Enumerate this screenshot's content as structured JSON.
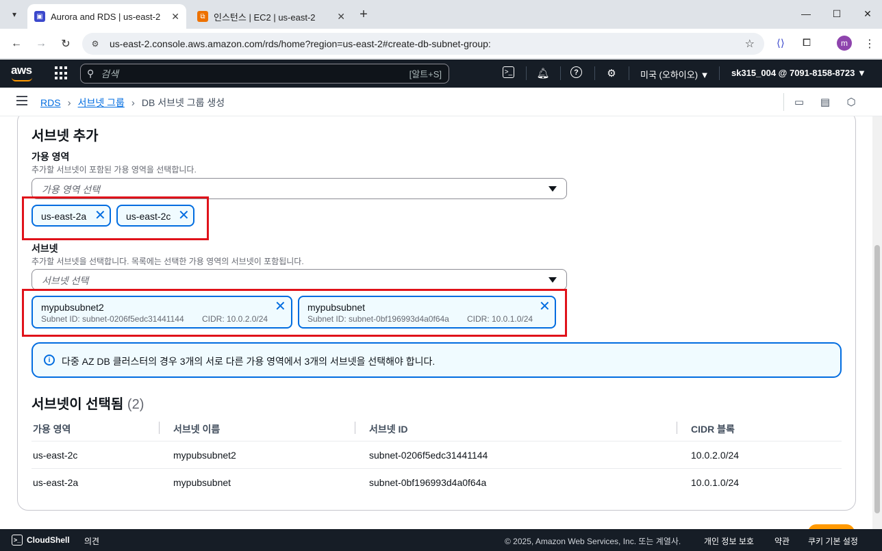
{
  "browser": {
    "tabs": [
      {
        "title": "Aurora and RDS | us-east-2",
        "active": true,
        "icon": "rds-favicon"
      },
      {
        "title": "인스턴스 | EC2 | us-east-2",
        "active": false,
        "icon": "ec2-favicon"
      }
    ],
    "url": "us-east-2.console.aws.amazon.com/rds/home?region=us-east-2#create-db-subnet-group:",
    "profile_initial": "m"
  },
  "aws_nav": {
    "logo": "aws",
    "search_placeholder": "검색",
    "search_shortcut": "[알트+S]",
    "region": "미국 (오하이오) ▼",
    "account": "sk315_004 @ 7091-8158-8723 ▼"
  },
  "breadcrumb": {
    "items": [
      "RDS",
      "서브넷 그룹"
    ],
    "current": "DB 서브넷 그룹 생성"
  },
  "form": {
    "section_title": "서브넷 추가",
    "az": {
      "label": "가용 영역",
      "description": "추가할 서브넷이 포함된 가용 영역을 선택합니다.",
      "placeholder": "가용 영역 선택",
      "tokens": [
        "us-east-2a",
        "us-east-2c"
      ]
    },
    "subnet": {
      "label": "서브넷",
      "description": "추가할 서브넷을 선택합니다. 목록에는 선택한 가용 영역의 서브넷이 포함됩니다.",
      "placeholder": "서브넷 선택",
      "tokens": [
        {
          "name": "mypubsubnet2",
          "subnet_id": "Subnet ID: subnet-0206f5edc31441144",
          "cidr": "CIDR: 10.0.2.0/24"
        },
        {
          "name": "mypubsubnet",
          "subnet_id": "Subnet ID: subnet-0bf196993d4a0f64a",
          "cidr": "CIDR: 10.0.1.0/24"
        }
      ]
    },
    "info": "다중 AZ DB 클러스터의 경우 3개의 서로 다른 가용 영역에서 3개의 서브넷을 선택해야 합니다."
  },
  "selected_table": {
    "title": "서브넷이 선택됨",
    "count": "(2)",
    "headers": [
      "가용 영역",
      "서브넷 이름",
      "서브넷 ID",
      "CIDR 블록"
    ],
    "rows": [
      [
        "us-east-2c",
        "mypubsubnet2",
        "subnet-0206f5edc31441144",
        "10.0.2.0/24"
      ],
      [
        "us-east-2a",
        "mypubsubnet",
        "subnet-0bf196993d4a0f64a",
        "10.0.1.0/24"
      ]
    ]
  },
  "footer": {
    "cloudshell": "CloudShell",
    "feedback": "의견",
    "copyright": "© 2025, Amazon Web Services, Inc. 또는 계열사.",
    "privacy": "개인 정보 보호",
    "terms": "약관",
    "cookies": "쿠키 기본 설정"
  }
}
